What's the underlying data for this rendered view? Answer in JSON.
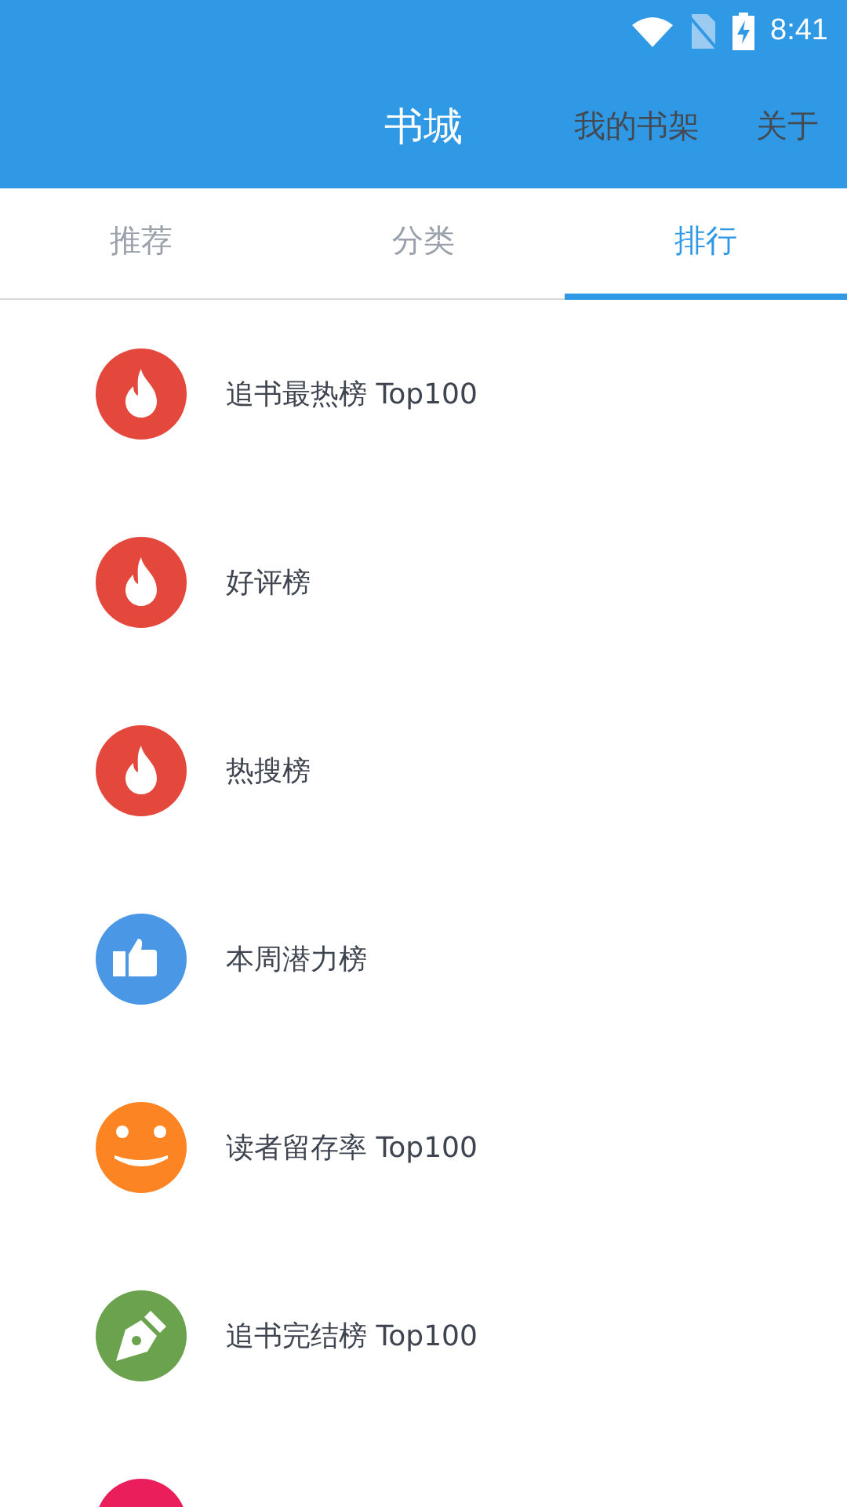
{
  "status_bar": {
    "time": "8:41"
  },
  "app_bar": {
    "title": "书城",
    "actions": [
      {
        "label": "我的书架"
      },
      {
        "label": "关于"
      }
    ]
  },
  "tabs": [
    {
      "label": "推荐",
      "selected": false
    },
    {
      "label": "分类",
      "selected": false
    },
    {
      "label": "排行",
      "selected": true
    }
  ],
  "rankings": [
    {
      "label": "追书最热榜 Top100",
      "kind": "fire",
      "color": "#e4473c"
    },
    {
      "label": "好评榜",
      "kind": "fire",
      "color": "#e4473c"
    },
    {
      "label": "热搜榜",
      "kind": "fire",
      "color": "#e4473c"
    },
    {
      "label": "本周潜力榜",
      "kind": "thumb",
      "color": "#4a97e5"
    },
    {
      "label": "读者留存率 Top100",
      "kind": "smile",
      "color": "#fd8423"
    },
    {
      "label": "追书完结榜 Top100",
      "kind": "pen",
      "color": "#6aa24d"
    },
    {
      "kind": "none",
      "color": "#e91e5a"
    }
  ]
}
